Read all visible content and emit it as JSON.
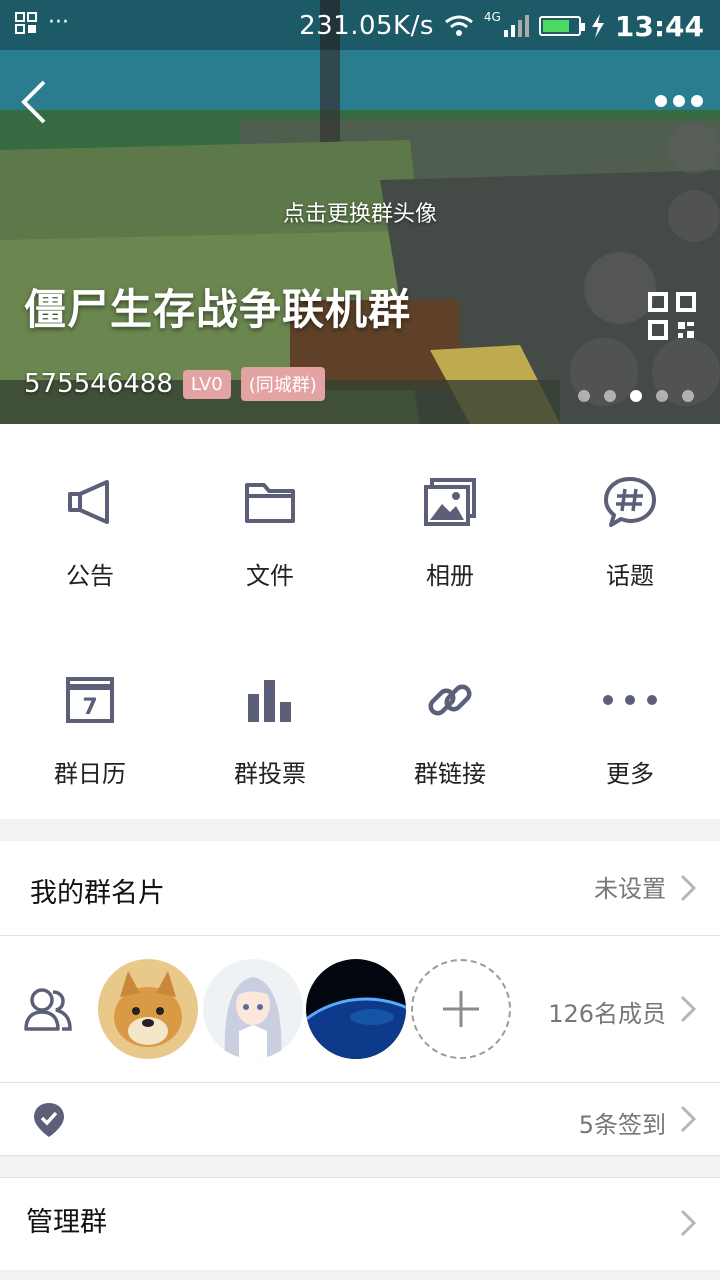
{
  "status_bar": {
    "speed": "231.05K/s",
    "network": "4G",
    "time": "13:44"
  },
  "header": {
    "change_avatar_hint": "点击更换群头像",
    "group_name": "僵尸生存战争联机群",
    "group_id": "575546488",
    "level_tag": "LV0",
    "city_tag": "(同城群)",
    "carousel_active_index": 2,
    "carousel_count": 5
  },
  "features": [
    {
      "label": "公告",
      "icon": "megaphone-icon"
    },
    {
      "label": "文件",
      "icon": "folder-icon"
    },
    {
      "label": "相册",
      "icon": "album-icon"
    },
    {
      "label": "话题",
      "icon": "topic-icon"
    },
    {
      "label": "群日历",
      "icon": "calendar-icon"
    },
    {
      "label": "群投票",
      "icon": "vote-icon"
    },
    {
      "label": "群链接",
      "icon": "link-icon"
    },
    {
      "label": "更多",
      "icon": "more-dots-icon"
    }
  ],
  "card": {
    "title": "我的群名片",
    "value": "未设置"
  },
  "members": {
    "count_label": "126名成员"
  },
  "checkin": {
    "value": "5条签到"
  },
  "manage": {
    "title": "管理群"
  },
  "colors": {
    "icon": "#5b6078",
    "tag": "#e4a3a3",
    "divider": "#e2e2e5",
    "page_bg": "#f2f2f4"
  }
}
